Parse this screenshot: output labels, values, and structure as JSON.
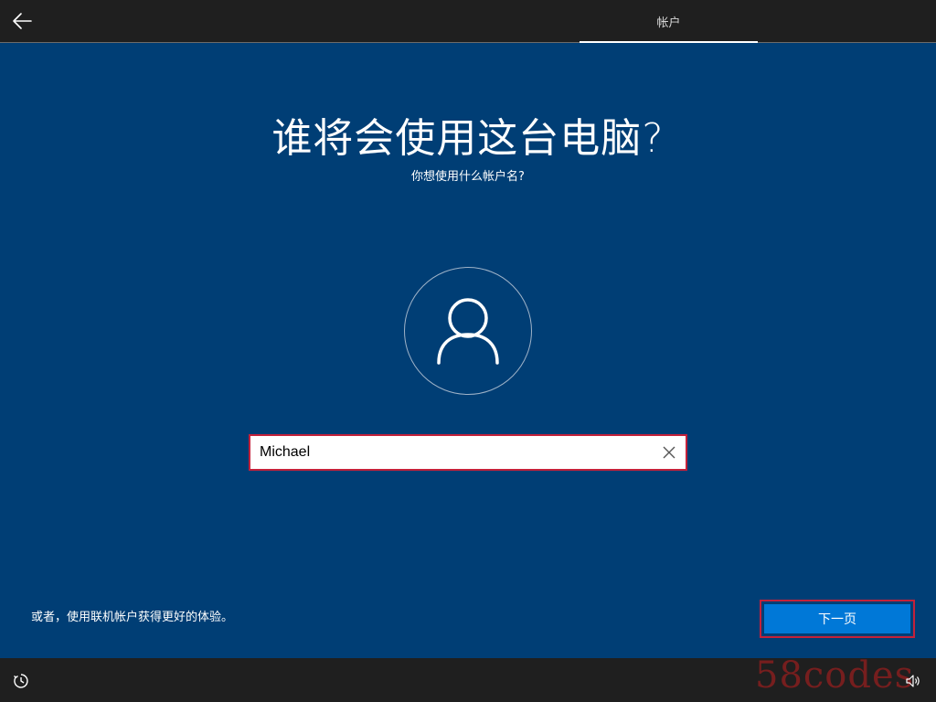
{
  "header": {
    "back_icon": "arrow-left-icon",
    "step_tab_label": "帐户"
  },
  "main": {
    "title": "谁将会使用这台电脑?",
    "subtitle": "你想使用什么帐户名?",
    "avatar_icon": "user-icon",
    "name_input": {
      "value": "Michael",
      "placeholder": "",
      "clear_icon": "close-icon"
    },
    "online_account_text": "或者，使用联机帐户获得更好的体验。",
    "next_button_label": "下一页"
  },
  "footer": {
    "ease_of_access_icon": "ease-of-access-icon",
    "volume_icon": "volume-icon"
  },
  "watermark": {
    "text": "58codes"
  },
  "colors": {
    "background": "#003e75",
    "bars": "#1f1f1f",
    "accent_button": "#0078d7",
    "highlight_border": "#c4213a"
  }
}
